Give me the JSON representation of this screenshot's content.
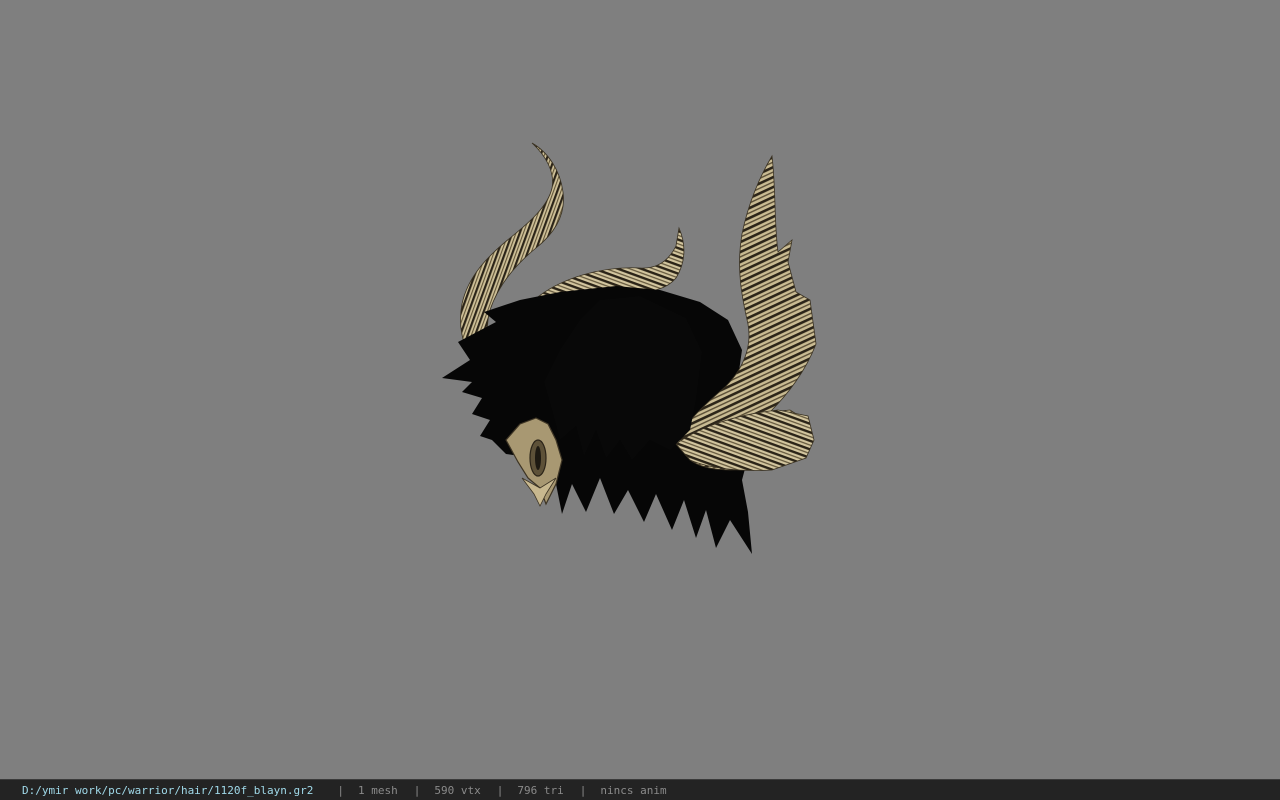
{
  "status_bar": {
    "file_path": "D:/ymir work/pc/warrior/hair/1120f_blayn.gr2",
    "separator": "|",
    "mesh_count": "1 mesh",
    "vertex_count": "590 vtx",
    "triangle_count": "796 tri",
    "anim_status": "nincs anim"
  },
  "viewport": {
    "background_color": "#7f7f7f",
    "model": "horned-black-hair-model"
  },
  "colors": {
    "horn_light": "#cbbd95",
    "horn_dark": "#2a2418",
    "hair": "#050505",
    "path_text": "#9fd8e8"
  }
}
